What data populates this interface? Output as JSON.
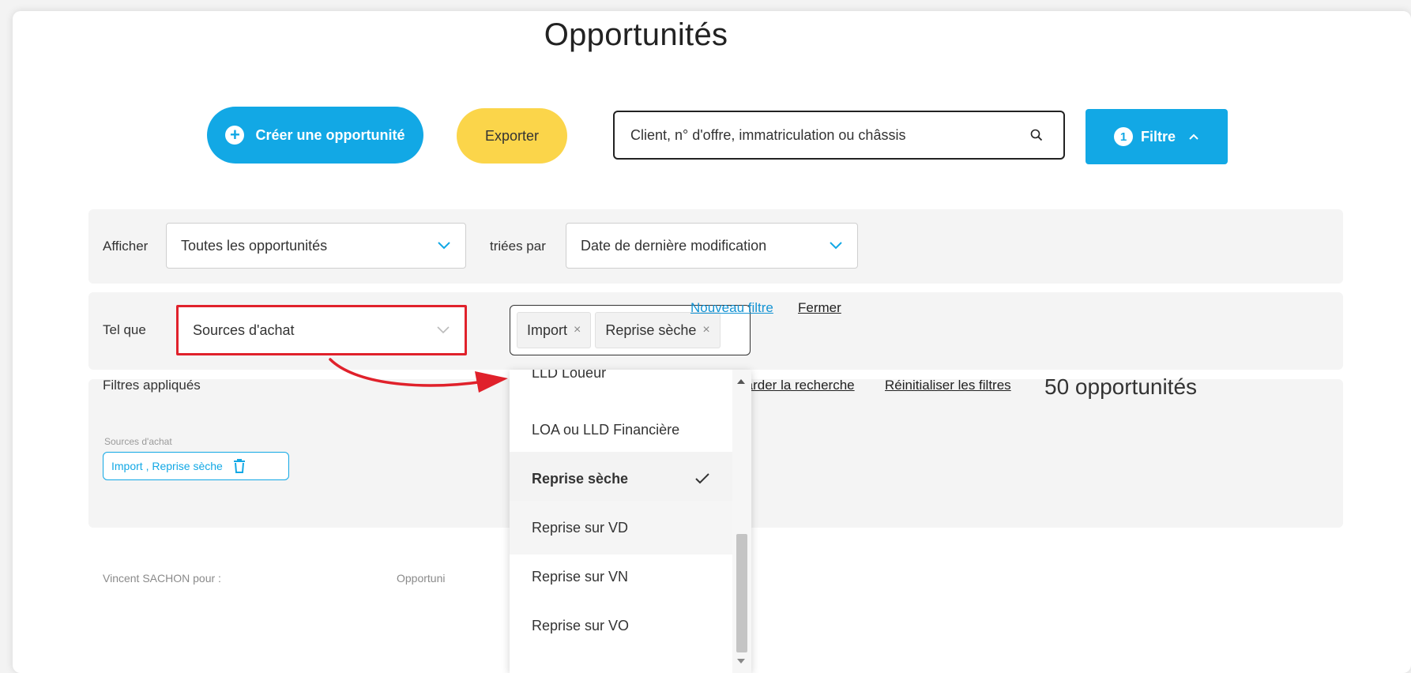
{
  "header": {
    "title": "Opportunités"
  },
  "toolbar": {
    "create_label": "Créer une opportunité",
    "export_label": "Exporter",
    "search_placeholder": "Client, n° d'offre, immatriculation ou châssis",
    "filter_count": "1",
    "filter_label": "Filtre"
  },
  "display_row": {
    "show_label": "Afficher",
    "show_value": "Toutes les opportunités",
    "sorted_label": "triées par",
    "sort_value": "Date de dernière modification"
  },
  "filter_row": {
    "tel_que_label": "Tel que",
    "field_value": "Sources d'achat",
    "tags": [
      "Import",
      "Reprise sèche"
    ],
    "new_filter_link": "Nouveau filtre",
    "close_link": "Fermer"
  },
  "applied": {
    "title": "Filtres appliqués",
    "save_link": "Sauvegarder la recherche",
    "reset_link": "Réinitialiser les filtres",
    "count": "50 opportunités",
    "chip_label": "Sources d'achat",
    "chip_value": "Import , Reprise sèche"
  },
  "bottom": {
    "user_label": "Vincent SACHON pour :",
    "opportunities_label": "Opportuni"
  },
  "dropdown": {
    "options": [
      "LLD Loueur",
      "LOA ou LLD Financière",
      "Reprise sèche",
      "Reprise sur VD",
      "Reprise sur VN",
      "Reprise sur VO"
    ],
    "selected": "Reprise sèche"
  },
  "colors": {
    "accent_blue": "#12a8e5",
    "export_yellow": "#fbd54a",
    "highlight_red": "#e0212b"
  },
  "icons": [
    "plus-circle-icon",
    "search-icon",
    "chevron-up-icon",
    "chevron-down-icon",
    "close-icon",
    "trash-icon",
    "check-icon"
  ]
}
